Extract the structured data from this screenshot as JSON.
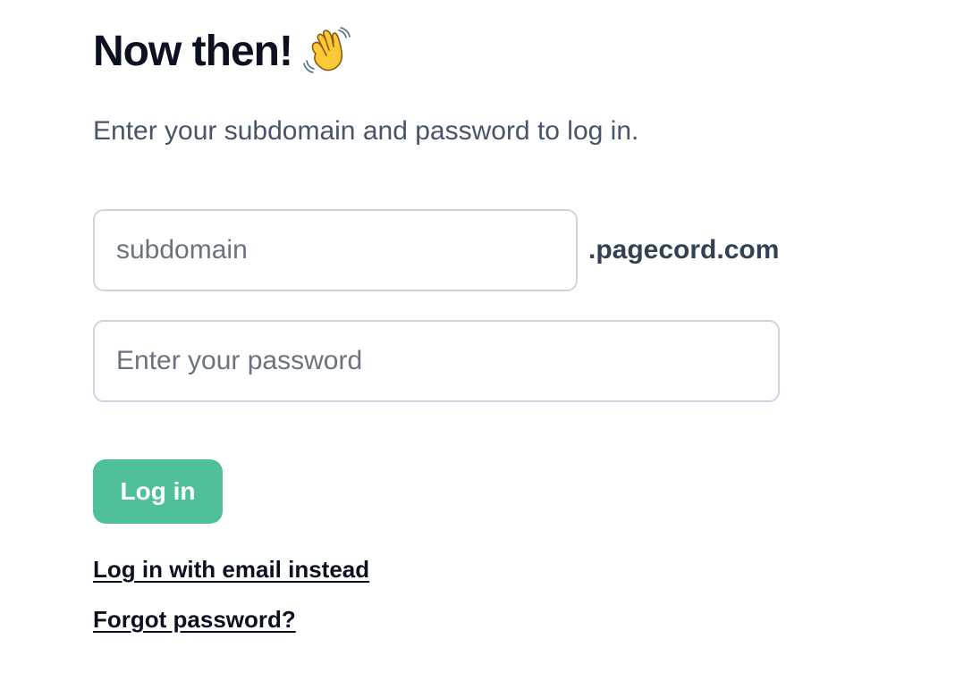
{
  "heading": {
    "text": "Now then!",
    "emoji_icon": "waving-hand-icon"
  },
  "subtitle": "Enter your subdomain and password to log in.",
  "form": {
    "subdomain": {
      "value": "",
      "placeholder": "subdomain",
      "suffix": ".pagecord.com"
    },
    "password": {
      "value": "",
      "placeholder": "Enter your password"
    },
    "submit_label": "Log in"
  },
  "links": {
    "email_login": "Log in with email instead",
    "forgot_password": "Forgot password?"
  },
  "colors": {
    "accent": "#50c09a",
    "heading": "#0b1120",
    "muted": "#475569",
    "border": "#cbd5e1"
  }
}
